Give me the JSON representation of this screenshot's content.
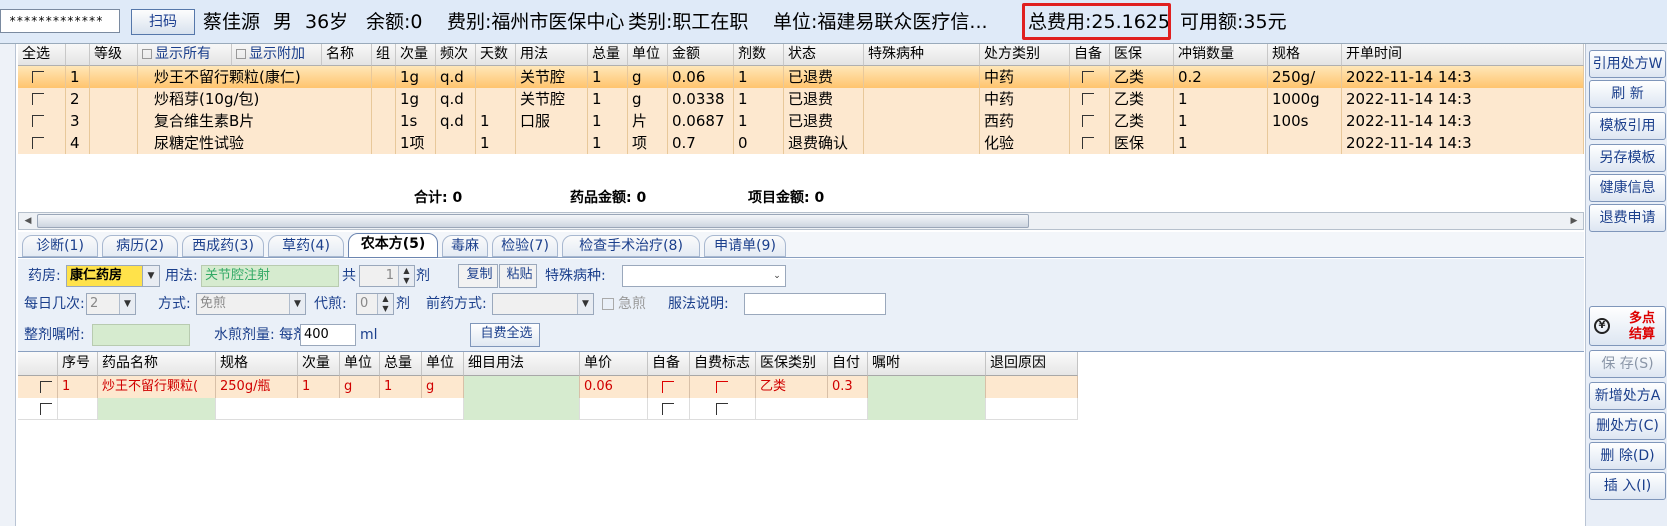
{
  "topbar": {
    "password_mask": "*************",
    "scan_button": "扫码",
    "patient_name": "蔡佳源",
    "gender": "男",
    "age": "36岁",
    "balance": "余额:0",
    "fee_type": "费别:福州市医保中心",
    "category": "类别:职工在职",
    "unit": "单位:福建易联众医疗信...",
    "total_fee": "总费用:25.1625",
    "available": "可用额:35元"
  },
  "right_buttons": [
    "引用处方W",
    "刷 新",
    "模板引用",
    "另存模板",
    "健康信息",
    "退费申请"
  ],
  "multi_settle": "多点\n结算",
  "lower_right_buttons": [
    "保 存(S)",
    "新增处方A",
    "删处方(C)",
    "删 除(D)",
    "插 入(I)"
  ],
  "grid1": {
    "toolbar": {
      "select_all": "全选",
      "grade": "等级",
      "show_all": "显示所有",
      "show_extra": "显示附加"
    },
    "headers": [
      "名称",
      "组",
      "次量",
      "频次",
      "天数",
      "用法",
      "总量",
      "单位",
      "金额",
      "剂数",
      "状态",
      "特殊病种",
      "处方类别",
      "自备",
      "医保",
      "冲销数量",
      "规格",
      "开单时间"
    ],
    "rows": [
      {
        "no": "1",
        "name": "炒王不留行颗粒(康仁)",
        "dose": "1g",
        "freq": "q.d",
        "days": "",
        "usage": "关节腔",
        "total": "1",
        "unit": "g",
        "amount": "0.06",
        "count": "1",
        "status": "已退费",
        "disease": "",
        "rx_type": "中药",
        "insurance": "乙类",
        "offset": "0.2",
        "spec": "250g/",
        "time": "2022-11-14 14:3"
      },
      {
        "no": "2",
        "name": "炒稻芽(10g/包)",
        "dose": "1g",
        "freq": "q.d",
        "days": "",
        "usage": "关节腔",
        "total": "1",
        "unit": "g",
        "amount": "0.0338",
        "count": "1",
        "status": "已退费",
        "disease": "",
        "rx_type": "中药",
        "insurance": "乙类",
        "offset": "1",
        "spec": "1000g",
        "time": "2022-11-14 14:3"
      },
      {
        "no": "3",
        "name": "复合维生素B片",
        "dose": "1s",
        "freq": "q.d",
        "days": "1",
        "usage": "口服",
        "total": "1",
        "unit": "片",
        "amount": "0.0687",
        "count": "1",
        "status": "已退费",
        "disease": "",
        "rx_type": "西药",
        "insurance": "乙类",
        "offset": "1",
        "spec": "100s",
        "time": "2022-11-14 14:3"
      },
      {
        "no": "4",
        "name": "尿糖定性试验",
        "dose": "1项",
        "freq": "",
        "days": "1",
        "usage": "",
        "total": "1",
        "unit": "项",
        "amount": "0.7",
        "count": "0",
        "status": "退费确认",
        "disease": "",
        "rx_type": "化验",
        "insurance": "医保",
        "offset": "1",
        "spec": "",
        "time": "2022-11-14 14:3"
      }
    ],
    "summary": {
      "total": "合计: 0",
      "drug_amount": "药品金额: 0",
      "item_amount": "项目金额: 0"
    }
  },
  "tabs": [
    "诊断(1)",
    "病历(2)",
    "西成药(3)",
    "草药(4)",
    "农本方(5)",
    "毒麻",
    "检验(7)",
    "检查手术治疗(8)",
    "申请单(9)"
  ],
  "form": {
    "pharmacy_label": "药房:",
    "pharmacy_value": "康仁药房",
    "usage_label": "用法:",
    "usage_value": "关节腔注射",
    "total_label": "共",
    "total_value": "1",
    "dose_unit": "剂",
    "copy_button": "复制",
    "paste_button": "粘贴",
    "special_disease_label": "特殊病种:",
    "daily_times_label": "每日几次:",
    "daily_times_value": "2",
    "method_label": "方式:",
    "method_value": "免煎",
    "decoct_label": "代煎:",
    "decoct_value": "0",
    "decoct_unit": "剂",
    "pre_decoct_label": "前药方式:",
    "urgent_label": "急煎",
    "instructions_label": "服法说明:",
    "advice_label": "整剂嘱咐:",
    "water_label": "水煎剂量: 每剂",
    "water_value": "400",
    "water_unit": "ml",
    "self_select_button": "自费全选"
  },
  "grid2": {
    "headers": [
      "序号",
      "药品名称",
      "规格",
      "次量",
      "单位",
      "总量",
      "单位",
      "细目用法",
      "单价",
      "自备",
      "自费标志",
      "医保类别",
      "自付",
      "嘱咐",
      "退回原因"
    ],
    "rows": [
      {
        "no": "1",
        "name": "炒王不留行颗粒(",
        "spec": "250g/瓶",
        "dose": "1",
        "unit": "g",
        "total": "1",
        "unit2": "g",
        "usage": "",
        "price": "0.06",
        "insurance": "乙类",
        "self_pay": "0.3"
      }
    ]
  }
}
